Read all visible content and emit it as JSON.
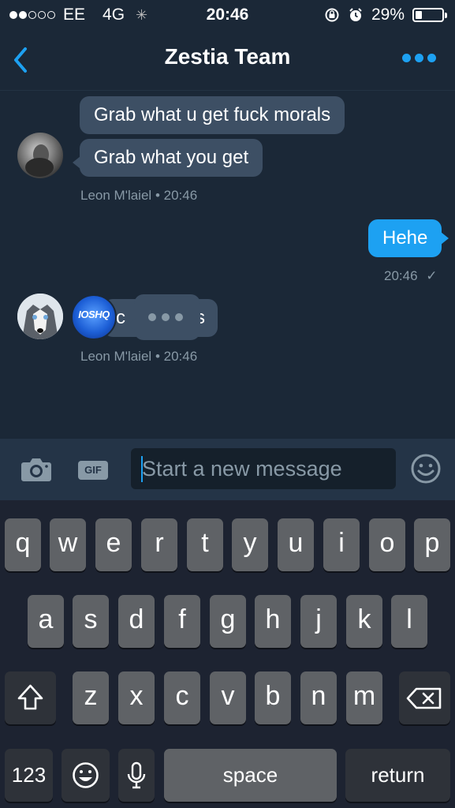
{
  "status_bar": {
    "carrier": "EE",
    "network": "4G",
    "time": "20:46",
    "battery": "29%",
    "battery_level": 0.29,
    "signal_bars_filled": 2,
    "signal_bars_total": 5
  },
  "nav": {
    "title": "Zestia Team",
    "back_icon": "chevron-left-icon",
    "more_icon": "more-horizontal-icon"
  },
  "messages": {
    "group1": {
      "bubble1": "Grab what u get fuck morals",
      "bubble2": "Grab what you get",
      "sender": "Leon M'laiel",
      "time": "20:46"
    },
    "outgoing": {
      "text": "Hehe",
      "time": "20:46"
    },
    "group2": {
      "bubble_left": "c",
      "bubble_right": "s",
      "badge_text": "IOSHQ",
      "sender": "Leon M'laiel",
      "time": "20:46"
    }
  },
  "composer": {
    "placeholder": "Start a new message",
    "gif_label": "GIF",
    "camera_icon": "camera-icon",
    "emoji_icon": "smiley-icon"
  },
  "keyboard": {
    "row1": [
      "q",
      "w",
      "e",
      "r",
      "t",
      "y",
      "u",
      "i",
      "o",
      "p"
    ],
    "row2": [
      "a",
      "s",
      "d",
      "f",
      "g",
      "h",
      "j",
      "k",
      "l"
    ],
    "row3": [
      "z",
      "x",
      "c",
      "v",
      "b",
      "n",
      "m"
    ],
    "numbers": "123",
    "space": "space",
    "return": "return"
  },
  "colors": {
    "background": "#1b2837",
    "accent": "#1da1f2",
    "incoming_bubble": "#3d4f64",
    "meta_text": "#8899a6"
  }
}
